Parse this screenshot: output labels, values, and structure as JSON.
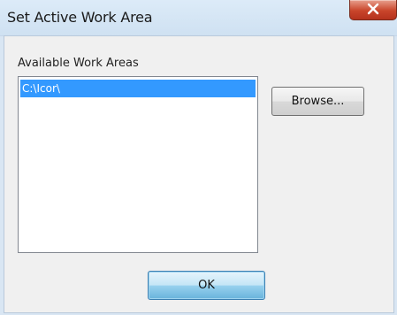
{
  "window": {
    "title": "Set Active Work Area",
    "close_icon": "close-icon"
  },
  "group": {
    "label": "Available Work Areas"
  },
  "list": {
    "items": [
      "C:\\Icor\\"
    ],
    "selected_index": 0,
    "selection_color": "#3399ff"
  },
  "buttons": {
    "browse_label": "Browse...",
    "ok_label": "OK"
  },
  "colors": {
    "close_button": "#c9452b",
    "titlebar": "#dcebf8"
  }
}
